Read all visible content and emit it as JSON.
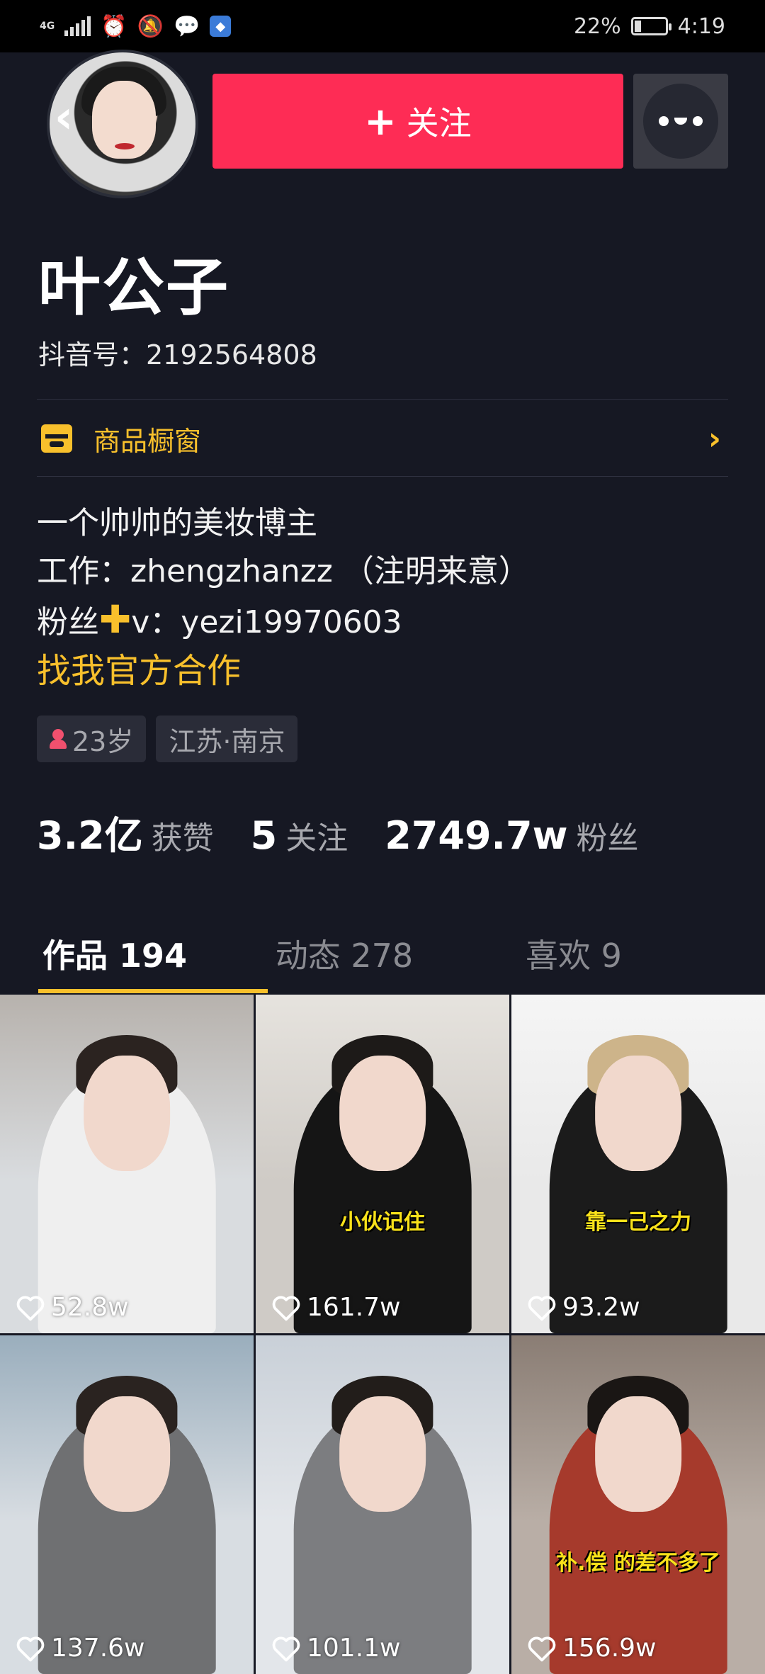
{
  "status_bar": {
    "network": "4G",
    "battery": "22%",
    "battery_level": 0.22,
    "time": "4:19"
  },
  "profile": {
    "follow_label": "关注",
    "name": "叶公子",
    "douyin_id": "抖音号：2192564808",
    "shop_label": "商品橱窗",
    "bio_lines": [
      "一个帅帅的美妆博主",
      "工作：zhengzhanzz （注明来意）"
    ],
    "bio_fans_prefix": "粉丝",
    "bio_fans_suffix": "v：yezi19970603",
    "coop_link": "找我官方合作",
    "tags": {
      "age": "23岁",
      "location": "江苏·南京"
    },
    "stats": [
      {
        "num": "3.2亿",
        "label": "获赞"
      },
      {
        "num": "5",
        "label": "关注"
      },
      {
        "num": "2749.7w",
        "label": "粉丝"
      }
    ]
  },
  "tabs": [
    {
      "label": "作品 194",
      "active": true
    },
    {
      "label": "动态 278",
      "active": false
    },
    {
      "label": "喜欢 9",
      "active": false
    }
  ],
  "videos": [
    {
      "likes": "52.8w",
      "caption": "",
      "bg": "#d9dcdf",
      "top": "#b7b2ad",
      "hair": "#2b2320",
      "outfit": "#efefef"
    },
    {
      "likes": "161.7w",
      "caption": "小伙记住",
      "bg": "#cfcbc6",
      "top": "#e6e3de",
      "hair": "#1d1a18",
      "outfit": "#151515"
    },
    {
      "likes": "93.2w",
      "caption": "靠一己之力",
      "bg": "#e9e9e9",
      "top": "#f5f5f5",
      "hair": "#cdb48a",
      "outfit": "#1b1b1b"
    },
    {
      "likes": "137.6w",
      "caption": "",
      "bg": "#d8dde2",
      "top": "#9aaebd",
      "hair": "#2a2320",
      "outfit": "#6f7072"
    },
    {
      "likes": "101.1w",
      "caption": "",
      "bg": "#e3e6ea",
      "top": "#c9d0d8",
      "hair": "#221d1a",
      "outfit": "#7c7d80"
    },
    {
      "likes": "156.9w",
      "caption": "补.偿 的差不多了",
      "bg": "#b9aea6",
      "top": "#8a7d74",
      "hair": "#1a1614",
      "outfit": "#a63a2c"
    }
  ]
}
